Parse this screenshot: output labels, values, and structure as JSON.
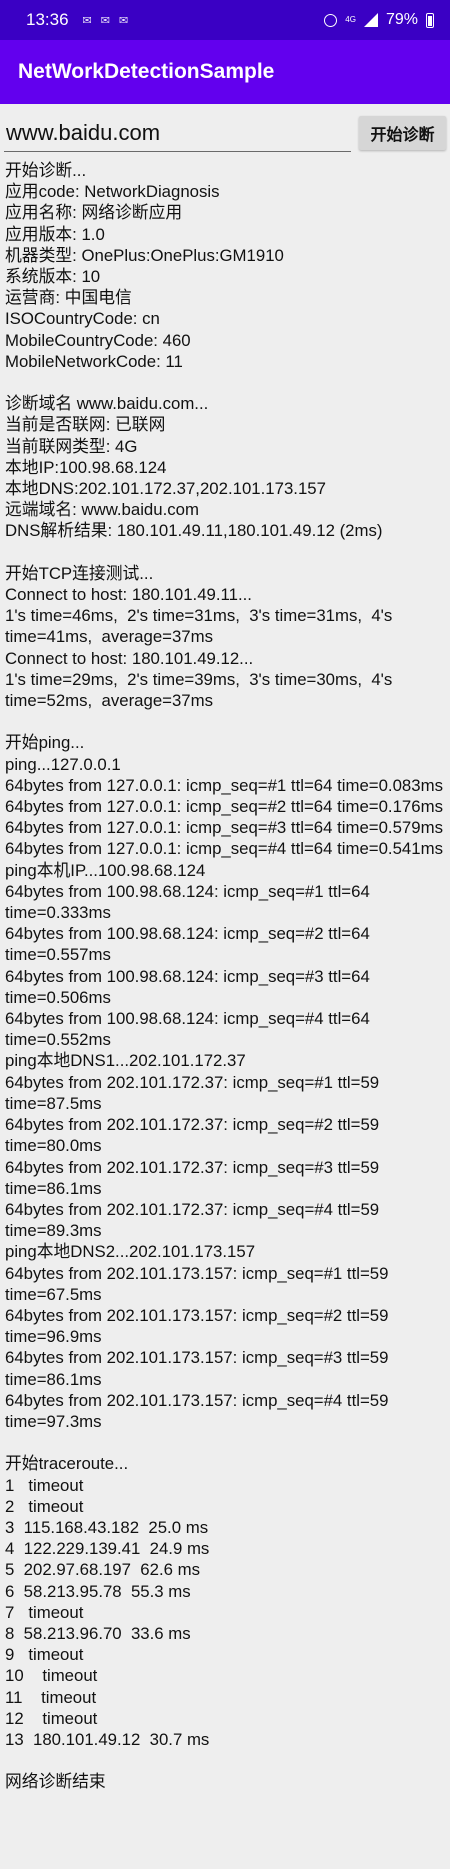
{
  "status_bar": {
    "time": "13:36",
    "notifications": [
      "✉",
      "✉",
      "✉"
    ],
    "network": "4G",
    "battery": "79%"
  },
  "app": {
    "title": "NetWorkDetectionSample"
  },
  "input": {
    "value": "www.baidu.com"
  },
  "start_button": {
    "label": "开始诊断"
  },
  "log_lines": [
    "开始诊断...",
    "应用code: NetworkDiagnosis",
    "应用名称: 网络诊断应用",
    "应用版本: 1.0",
    "机器类型: OnePlus:OnePlus:GM1910",
    "系统版本: 10",
    "运营商: 中国电信",
    "ISOCountryCode: cn",
    "MobileCountryCode: 460",
    "MobileNetworkCode: 11",
    "",
    "诊断域名 www.baidu.com...",
    "当前是否联网: 已联网",
    "当前联网类型: 4G",
    "本地IP:100.98.68.124",
    "本地DNS:202.101.172.37,202.101.173.157",
    "远端域名: www.baidu.com",
    "DNS解析结果: 180.101.49.11,180.101.49.12 (2ms)",
    "",
    "开始TCP连接测试...",
    "Connect to host: 180.101.49.11...",
    "1's time=46ms,  2's time=31ms,  3's time=31ms,  4's time=41ms,  average=37ms",
    "Connect to host: 180.101.49.12...",
    "1's time=29ms,  2's time=39ms,  3's time=30ms,  4's time=52ms,  average=37ms",
    "",
    "开始ping...",
    "ping...127.0.0.1",
    "64bytes from 127.0.0.1: icmp_seq=#1 ttl=64 time=0.083ms",
    "64bytes from 127.0.0.1: icmp_seq=#2 ttl=64 time=0.176ms",
    "64bytes from 127.0.0.1: icmp_seq=#3 ttl=64 time=0.579ms",
    "64bytes from 127.0.0.1: icmp_seq=#4 ttl=64 time=0.541ms",
    "ping本机IP...100.98.68.124",
    "64bytes from 100.98.68.124: icmp_seq=#1 ttl=64 time=0.333ms",
    "64bytes from 100.98.68.124: icmp_seq=#2 ttl=64 time=0.557ms",
    "64bytes from 100.98.68.124: icmp_seq=#3 ttl=64 time=0.506ms",
    "64bytes from 100.98.68.124: icmp_seq=#4 ttl=64 time=0.552ms",
    "ping本地DNS1...202.101.172.37",
    "64bytes from 202.101.172.37: icmp_seq=#1 ttl=59 time=87.5ms",
    "64bytes from 202.101.172.37: icmp_seq=#2 ttl=59 time=80.0ms",
    "64bytes from 202.101.172.37: icmp_seq=#3 ttl=59 time=86.1ms",
    "64bytes from 202.101.172.37: icmp_seq=#4 ttl=59 time=89.3ms",
    "ping本地DNS2...202.101.173.157",
    "64bytes from 202.101.173.157: icmp_seq=#1 ttl=59 time=67.5ms",
    "64bytes from 202.101.173.157: icmp_seq=#2 ttl=59 time=96.9ms",
    "64bytes from 202.101.173.157: icmp_seq=#3 ttl=59 time=86.1ms",
    "64bytes from 202.101.173.157: icmp_seq=#4 ttl=59 time=97.3ms",
    "",
    "开始traceroute...",
    "1   timeout",
    "2   timeout",
    "3  115.168.43.182  25.0 ms",
    "4  122.229.139.41  24.9 ms",
    "5  202.97.68.197  62.6 ms",
    "6  58.213.95.78  55.3 ms",
    "7   timeout",
    "8  58.213.96.70  33.6 ms",
    "9   timeout",
    "10    timeout",
    "11    timeout",
    "12    timeout",
    "13  180.101.49.12  30.7 ms",
    "",
    "网络诊断结束"
  ]
}
